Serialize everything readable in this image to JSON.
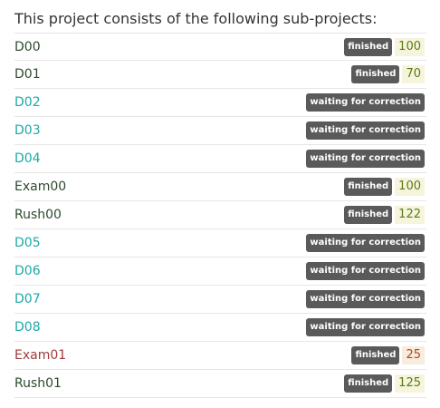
{
  "section": {
    "title": "This project consists of the following sub-projects:"
  },
  "subprojects": [
    {
      "name": "D00",
      "status": "finished",
      "score": "100",
      "style": "plain"
    },
    {
      "name": "D01",
      "status": "finished",
      "score": "70",
      "style": "plain"
    },
    {
      "name": "D02",
      "status": "waiting for correction",
      "score": null,
      "style": "link"
    },
    {
      "name": "D03",
      "status": "waiting for correction",
      "score": null,
      "style": "link"
    },
    {
      "name": "D04",
      "status": "waiting for correction",
      "score": null,
      "style": "link"
    },
    {
      "name": "Exam00",
      "status": "finished",
      "score": "100",
      "style": "plain"
    },
    {
      "name": "Rush00",
      "status": "finished",
      "score": "122",
      "style": "plain"
    },
    {
      "name": "D05",
      "status": "waiting for correction",
      "score": null,
      "style": "link"
    },
    {
      "name": "D06",
      "status": "waiting for correction",
      "score": null,
      "style": "link"
    },
    {
      "name": "D07",
      "status": "waiting for correction",
      "score": null,
      "style": "link"
    },
    {
      "name": "D08",
      "status": "waiting for correction",
      "score": null,
      "style": "link"
    },
    {
      "name": "Exam01",
      "status": "finished",
      "score": "25",
      "style": "fail"
    },
    {
      "name": "Rush01",
      "status": "finished",
      "score": "125",
      "style": "plain"
    }
  ],
  "colors": {
    "link": "#1fa8a8",
    "plain": "#2e4a2e",
    "fail": "#a23a3a",
    "badge": "#5a5a5a",
    "score_ok": "#5b7a16",
    "score_fail": "#b1452d"
  }
}
